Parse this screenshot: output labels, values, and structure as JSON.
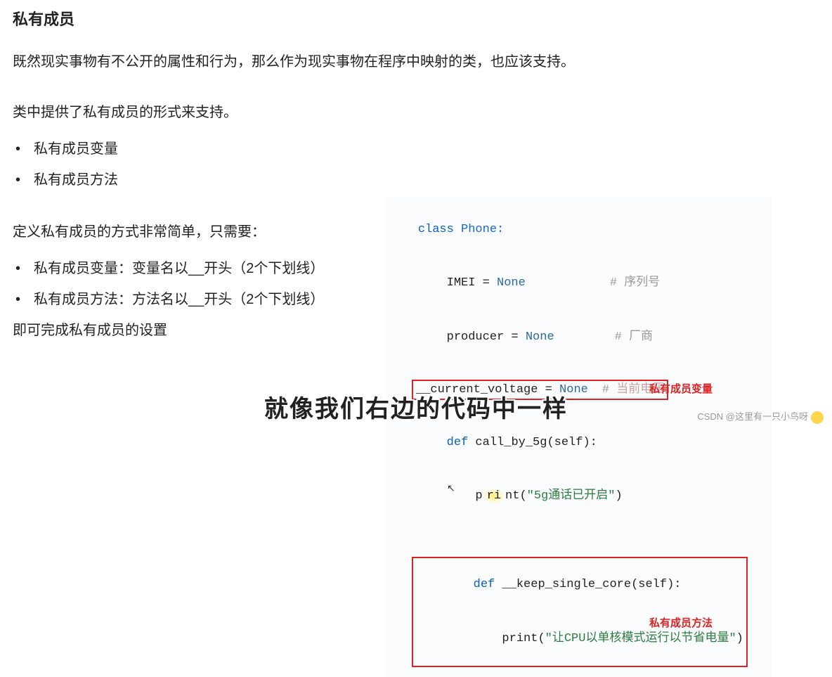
{
  "title": "私有成员",
  "paragraph1": "既然现实事物有不公开的属性和行为，那么作为现实事物在程序中映射的类，也应该支持。",
  "paragraph2": "类中提供了私有成员的形式来支持。",
  "bullets1": [
    "私有成员变量",
    "私有成员方法"
  ],
  "paragraph3": "定义私有成员的方式非常简单，只需要：",
  "bullets2": [
    "私有成员变量：变量名以__开头（2个下划线）",
    "私有成员方法：方法名以__开头（2个下划线）"
  ],
  "paragraph4": "即可完成私有成员的设置",
  "code": {
    "l1_kw": "class",
    "l1_cls": " Phone:",
    "l2": "    IMEI = ",
    "l2_none": "None",
    "l2_cmt": "# 序列号",
    "l3": "    producer = ",
    "l3_none": "None",
    "l3_cmt": "# 厂商",
    "l4a": "__current_voltage = ",
    "l4_none": "None",
    "l4_cmt": "#",
    "l4_cmt2": " 当前电压",
    "box_label1": "私有成员变量",
    "l5_kw": "def",
    "l5": " call_by_5g(self):",
    "l6a": "        p",
    "l6b": "ri",
    "l6c": "nt(",
    "l6_str": "\"5g通话已开启\"",
    "l6d": ")",
    "l7_kw": "def",
    "l7": " __keep_single_core(self):",
    "l8": "    print(",
    "l8_str": "\"让CPU以单核模式运行以节省电量\"",
    "l8b": ")",
    "box_label2": "私有成员方法"
  },
  "subtitle": "就像我们右边的代码中一样",
  "watermark": "CSDN @这里有一只小鸟呀"
}
